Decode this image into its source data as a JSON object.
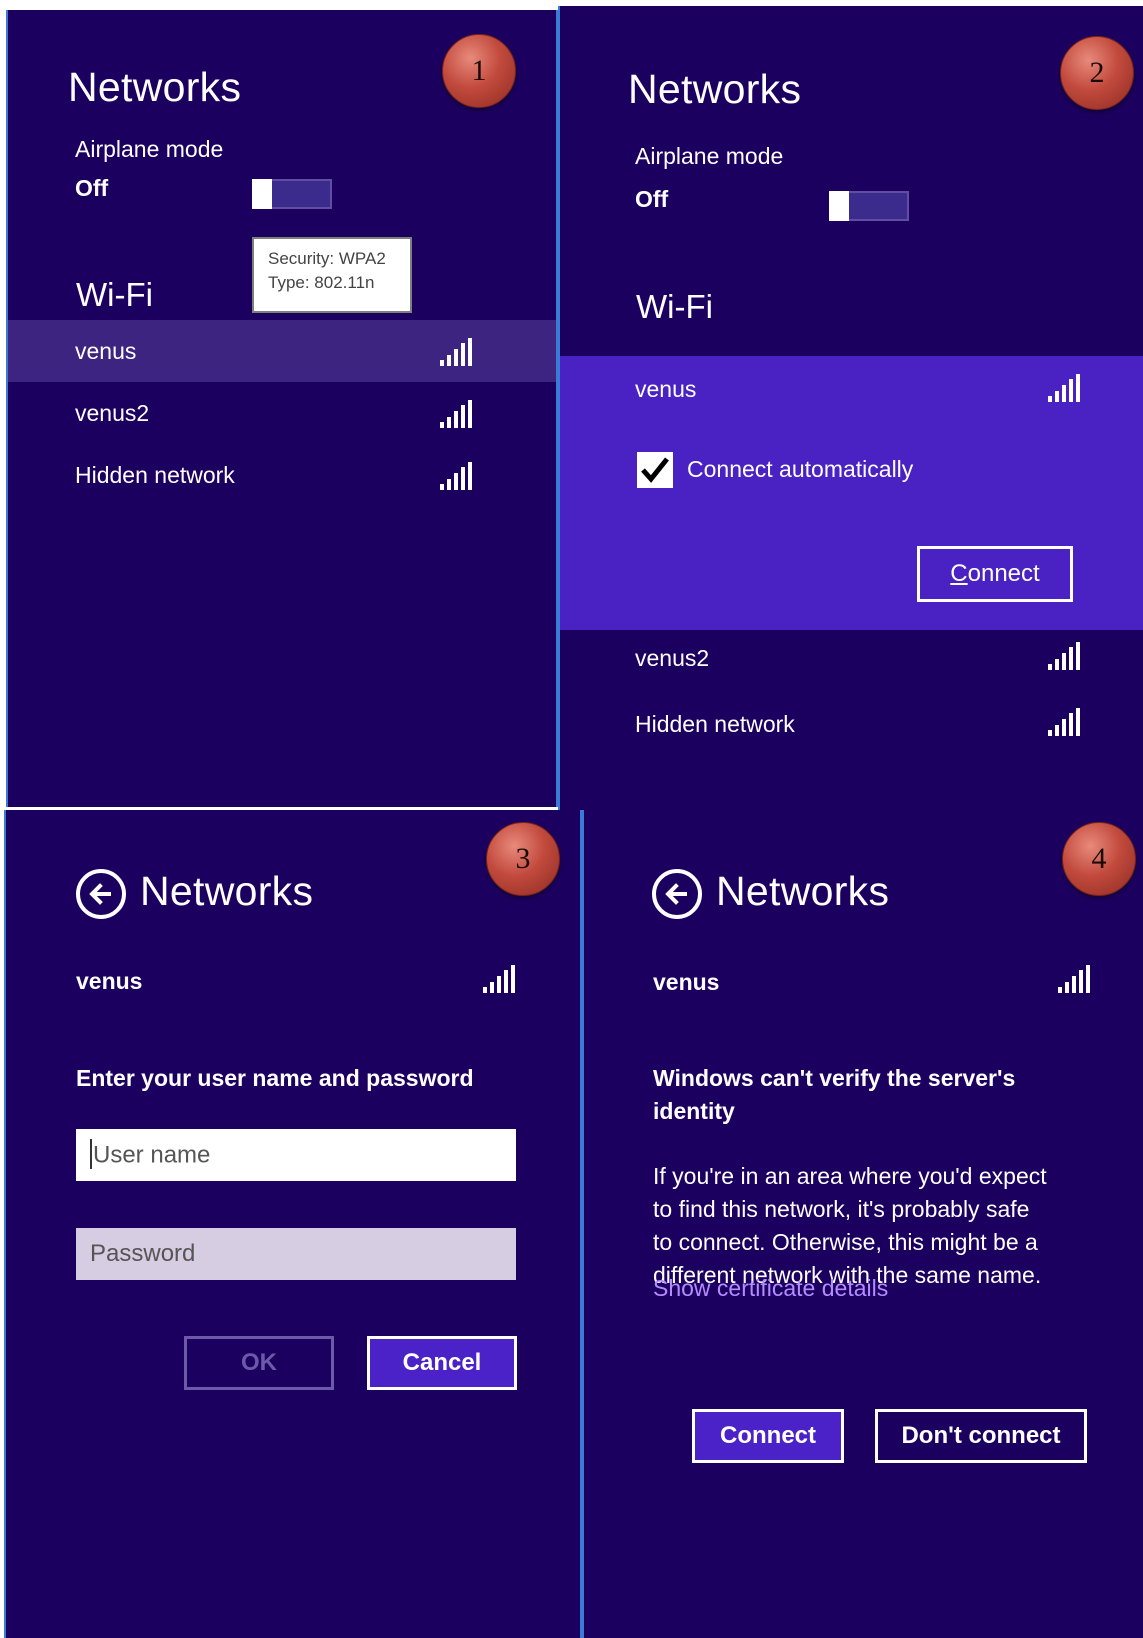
{
  "panel1": {
    "badge": "1",
    "title": "Networks",
    "airplane_label": "Airplane mode",
    "airplane_state": "Off",
    "tooltip_line1": "Security: WPA2",
    "tooltip_line2": "Type: 802.11n",
    "wifi_header": "Wi-Fi",
    "networks": [
      {
        "name": "venus",
        "selected": true
      },
      {
        "name": "venus2"
      },
      {
        "name": "Hidden network"
      }
    ]
  },
  "panel2": {
    "badge": "2",
    "title": "Networks",
    "airplane_label": "Airplane mode",
    "airplane_state": "Off",
    "wifi_header": "Wi-Fi",
    "expanded_network": "venus",
    "connect_auto_label": "Connect automatically",
    "connect_auto_checked": true,
    "connect_button_rest": "onnect",
    "connect_button_accel": "C",
    "networks": [
      {
        "name": "venus2"
      },
      {
        "name": "Hidden network"
      }
    ]
  },
  "panel3": {
    "badge": "3",
    "title": "Networks",
    "network": "venus",
    "prompt": "Enter your user name and password",
    "username_placeholder": "User name",
    "password_placeholder": "Password",
    "ok_label": "OK",
    "cancel_label": "Cancel"
  },
  "panel4": {
    "badge": "4",
    "title": "Networks",
    "network": "venus",
    "heading_line1": "Windows can't verify the server's",
    "heading_line2": "identity",
    "body_lines": [
      "If you're in an area where you'd expect",
      "to find this network, it's probably safe",
      "to connect. Otherwise, this might be a",
      "different network with the same name."
    ],
    "cert_link": "Show certificate details",
    "connect_label": "Connect",
    "dont_connect_label": "Don't connect"
  },
  "colors": {
    "panel_bg": "#1c0060",
    "selected_row": "#3c2480",
    "expanded_bg": "#4a22c4",
    "link": "#b48cff",
    "badge": "#c24a3d"
  }
}
